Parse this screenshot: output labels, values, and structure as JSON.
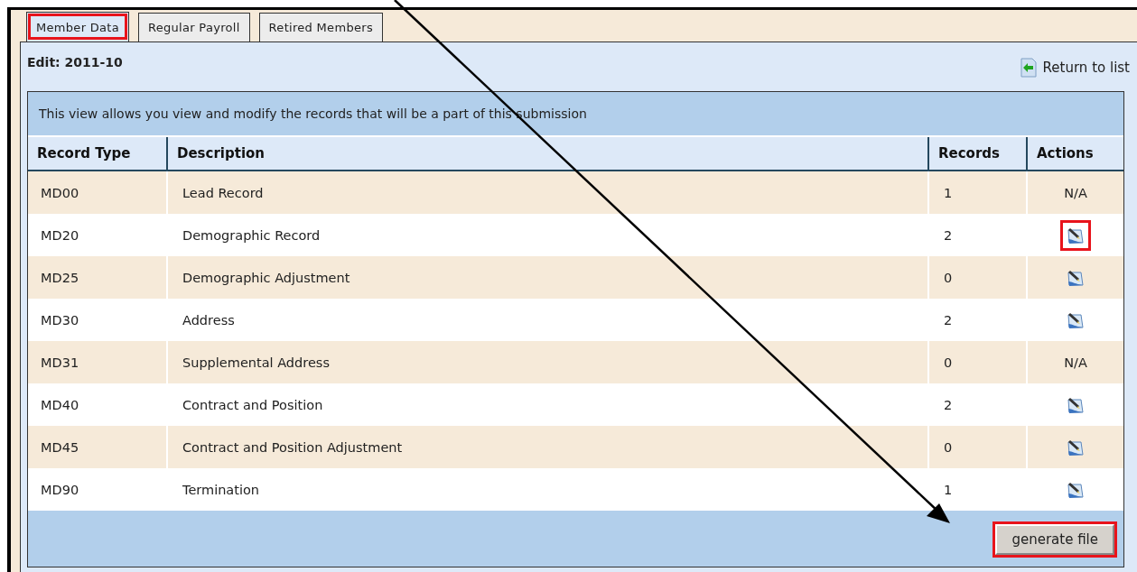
{
  "tabs": [
    {
      "label": "Member Data",
      "selected": true,
      "highlighted": true
    },
    {
      "label": "Regular Payroll",
      "selected": false,
      "highlighted": false
    },
    {
      "label": "Retired Members",
      "selected": false,
      "highlighted": false
    }
  ],
  "edit_title": "Edit: 2011-10",
  "return_link": "Return to list",
  "table": {
    "caption": "This view allows you view and modify the records that will be a part of this submission",
    "columns": [
      "Record Type",
      "Description",
      "Records",
      "Actions"
    ],
    "rows": [
      {
        "record_type": "MD00",
        "description": "Lead Record",
        "records": "1",
        "action": {
          "kind": "text",
          "text": "N/A",
          "highlighted": false
        }
      },
      {
        "record_type": "MD20",
        "description": "Demographic Record",
        "records": "2",
        "action": {
          "kind": "edit",
          "highlighted": true
        }
      },
      {
        "record_type": "MD25",
        "description": "Demographic Adjustment",
        "records": "0",
        "action": {
          "kind": "edit",
          "highlighted": false
        }
      },
      {
        "record_type": "MD30",
        "description": "Address",
        "records": "2",
        "action": {
          "kind": "edit",
          "highlighted": false
        }
      },
      {
        "record_type": "MD31",
        "description": "Supplemental Address",
        "records": "0",
        "action": {
          "kind": "text",
          "text": "N/A",
          "highlighted": false
        }
      },
      {
        "record_type": "MD40",
        "description": "Contract and Position",
        "records": "2",
        "action": {
          "kind": "edit",
          "highlighted": false
        }
      },
      {
        "record_type": "MD45",
        "description": "Contract and Position Adjustment",
        "records": "0",
        "action": {
          "kind": "edit",
          "highlighted": false
        }
      },
      {
        "record_type": "MD90",
        "description": "Termination",
        "records": "1",
        "action": {
          "kind": "edit",
          "highlighted": false
        }
      }
    ]
  },
  "generate_button": {
    "label": "generate file",
    "highlighted": true
  }
}
